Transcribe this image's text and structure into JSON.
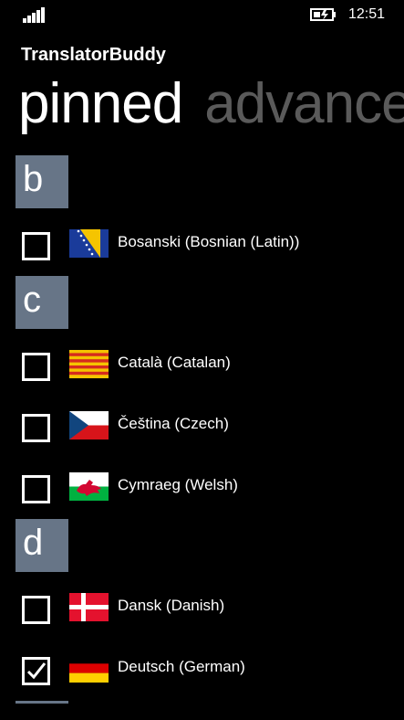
{
  "status": {
    "time": "12:51"
  },
  "app": {
    "title": "TranslatorBuddy"
  },
  "pivot": {
    "active": "pinned",
    "next": "advanced"
  },
  "groups": [
    {
      "letter": "b"
    },
    {
      "letter": "c"
    },
    {
      "letter": "d"
    }
  ],
  "languages": [
    {
      "label": "Bosanski (Bosnian (Latin))",
      "checked": false,
      "flag": "bosnia-flag-icon"
    },
    {
      "label": "Català (Catalan)",
      "checked": false,
      "flag": "catalonia-flag-icon"
    },
    {
      "label": "Čeština (Czech)",
      "checked": false,
      "flag": "czech-flag-icon"
    },
    {
      "label": "Cymraeg (Welsh)",
      "checked": false,
      "flag": "wales-flag-icon"
    },
    {
      "label": "Dansk (Danish)",
      "checked": false,
      "flag": "denmark-flag-icon"
    },
    {
      "label": "Deutsch (German)",
      "checked": true,
      "flag": "germany-flag-icon"
    }
  ],
  "colors": {
    "group_tile": "#677587",
    "inactive_pivot": "#5a5a5a"
  }
}
